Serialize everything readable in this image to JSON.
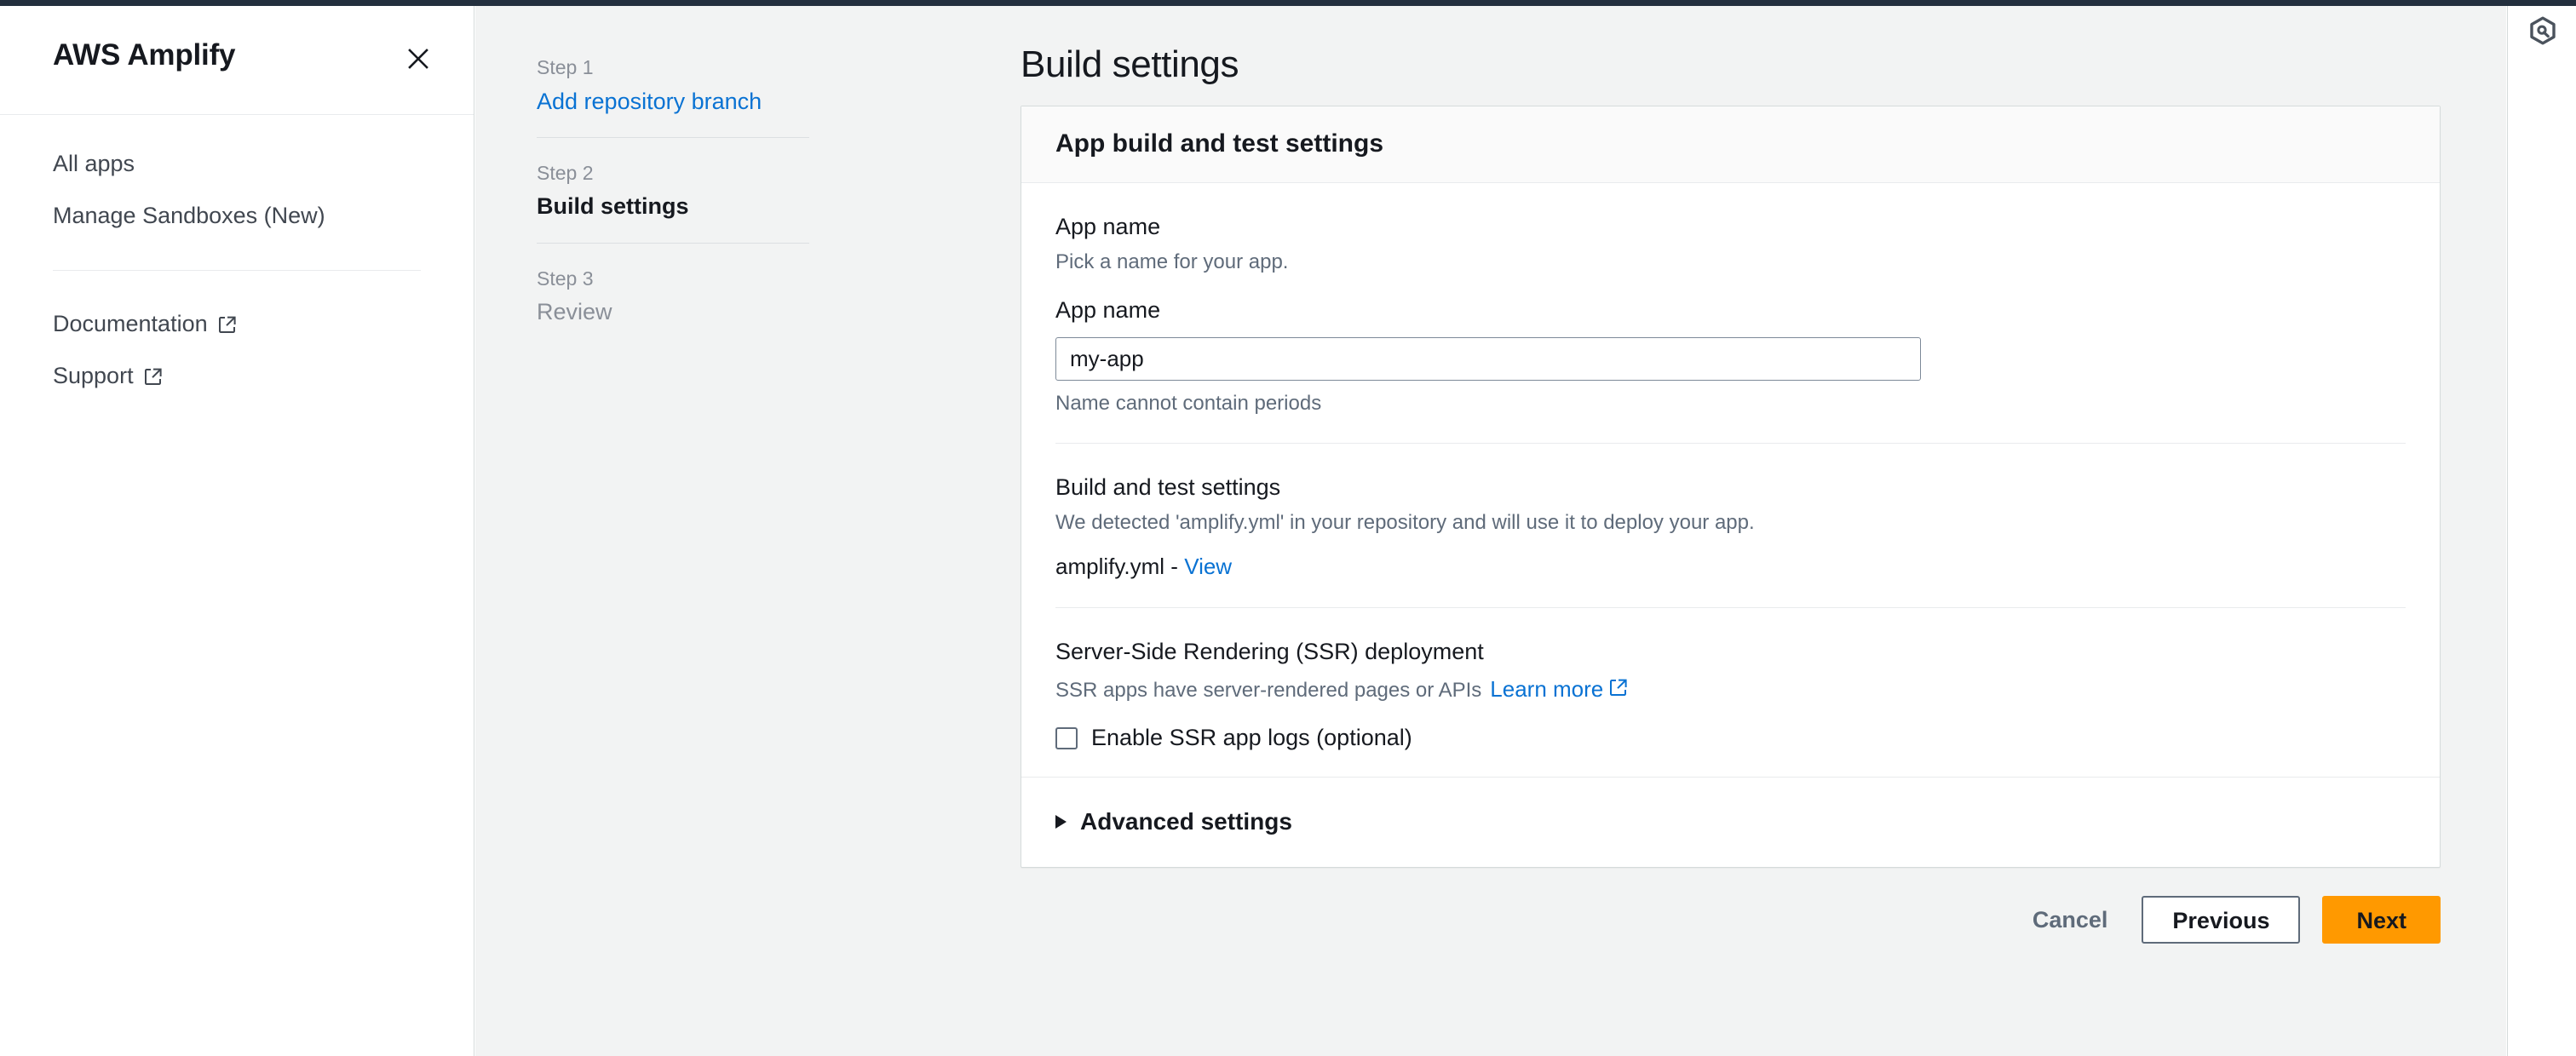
{
  "left_nav": {
    "title": "AWS Amplify",
    "close_icon": "close-icon",
    "items": [
      {
        "label": "All apps",
        "external": false
      },
      {
        "label": "Manage Sandboxes (New)",
        "external": false
      }
    ],
    "secondary_items": [
      {
        "label": "Documentation",
        "external": true
      },
      {
        "label": "Support",
        "external": true
      }
    ]
  },
  "wizard": {
    "steps": [
      {
        "kicker": "Step 1",
        "name": "Add repository branch",
        "state": "link"
      },
      {
        "kicker": "Step 2",
        "name": "Build settings",
        "state": "current"
      },
      {
        "kicker": "Step 3",
        "name": "Review",
        "state": "upcoming"
      }
    ]
  },
  "page": {
    "title": "Build settings"
  },
  "card": {
    "header_title": "App build and test settings",
    "app_name_section": {
      "title": "App name",
      "description": "Pick a name for your app.",
      "field_label": "App name",
      "input_value": "my-app",
      "input_placeholder": "",
      "hint": "Name cannot contain periods"
    },
    "build_test_section": {
      "title": "Build and test settings",
      "description": "We detected 'amplify.yml' in your repository and will use it to deploy your app.",
      "file_name": "amplify.yml - ",
      "file_link": "View"
    },
    "ssr_section": {
      "title": "Server-Side Rendering (SSR) deployment",
      "description": "SSR apps have server-rendered pages or APIs",
      "learn_more": "Learn more",
      "learn_more_icon": "external-link-icon",
      "checkbox_label": "Enable SSR app logs (optional)",
      "checkbox_checked": false
    },
    "advanced": {
      "caret_icon": "caret-right-icon",
      "label": "Advanced settings",
      "expanded": false
    }
  },
  "footer": {
    "cancel_label": "Cancel",
    "previous_label": "Previous",
    "next_label": "Next"
  },
  "right_panel": {
    "icon": "amazon-q-hexagon-icon"
  },
  "colors": {
    "accent_link": "#0972d3",
    "primary_button": "#ff9900",
    "console_strip": "#232f3e",
    "canvas": "#f2f3f3"
  }
}
